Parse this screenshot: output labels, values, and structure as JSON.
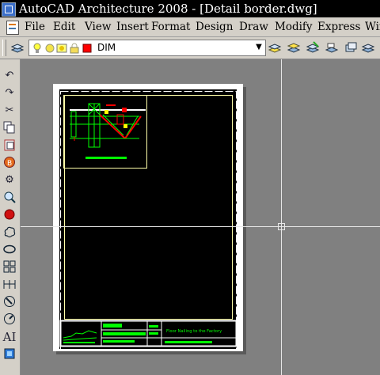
{
  "window": {
    "title": "AutoCAD Architecture 2008 - [Detail border.dwg]"
  },
  "menu": [
    "File",
    "Edit",
    "View",
    "Insert",
    "Format",
    "Design",
    "Draw",
    "Modify",
    "Express",
    "Win"
  ],
  "layers_toolbar": {
    "current_layer": "DIM"
  },
  "drawing": {
    "title_block_caption": "Floor Nailing to the Factory"
  },
  "colors": {
    "line_green": "#00ff00",
    "line_yellow": "#ffff00",
    "line_red": "#ff0000",
    "line_white": "#ffffff",
    "canvas_gray": "#808080"
  }
}
